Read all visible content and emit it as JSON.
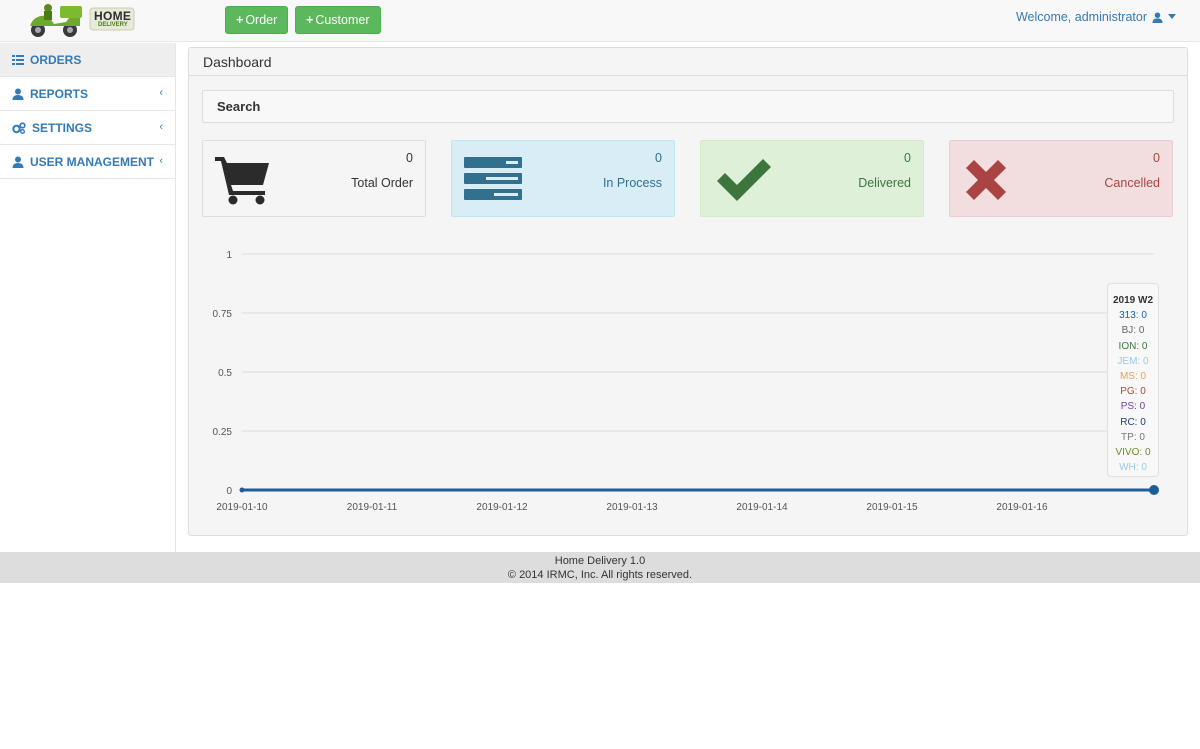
{
  "header": {
    "logo": {
      "line1": "HOME",
      "line2": "DELIVERY"
    },
    "order_button": "Order",
    "customer_button": "Customer",
    "welcome": "Welcome, administrator"
  },
  "sidebar": {
    "items": [
      {
        "label": "ORDERS",
        "icon": "list-icon",
        "active": true
      },
      {
        "label": "REPORTS",
        "icon": "user-icon"
      },
      {
        "label": "SETTINGS",
        "icon": "gears-icon"
      },
      {
        "label": "USER MANAGEMENT",
        "icon": "user-icon"
      }
    ]
  },
  "dashboard": {
    "title": "Dashboard",
    "search_label": "Search",
    "cards": [
      {
        "value": "0",
        "label": "Total Order",
        "icon": "cart-icon",
        "color": "#333333"
      },
      {
        "value": "0",
        "label": "In Process",
        "icon": "tasks-icon",
        "color": "#31708f"
      },
      {
        "value": "0",
        "label": "Delivered",
        "icon": "check-icon",
        "color": "#3c763d"
      },
      {
        "value": "0",
        "label": "Cancelled",
        "icon": "close-icon",
        "color": "#a94442"
      }
    ]
  },
  "chart_data": {
    "type": "line",
    "x": [
      "2019-01-10",
      "2019-01-11",
      "2019-01-12",
      "2019-01-13",
      "2019-01-14",
      "2019-01-15",
      "2019-01-16",
      "2019 W2"
    ],
    "x_ticks": [
      "2019-01-10",
      "2019-01-11",
      "2019-01-12",
      "2019-01-13",
      "2019-01-14",
      "2019-01-15",
      "2019-01-16"
    ],
    "y_ticks": [
      "0",
      "0.25",
      "0.5",
      "0.75",
      "1"
    ],
    "ylim": [
      0,
      1
    ],
    "series": [
      {
        "name": "313",
        "values": [
          0,
          0,
          0,
          0,
          0,
          0,
          0,
          0
        ],
        "color": "#1f5d99"
      }
    ],
    "tooltip": {
      "title": "2019 W2",
      "rows": [
        {
          "name": "313",
          "value": "0",
          "color": "#1f5d99"
        },
        {
          "name": "BJ",
          "value": "0",
          "color": "#666666"
        },
        {
          "name": "ION",
          "value": "0",
          "color": "#3c763d"
        },
        {
          "name": "JEM",
          "value": "0",
          "color": "#9ac8e0"
        },
        {
          "name": "MS",
          "value": "0",
          "color": "#e8a34a"
        },
        {
          "name": "PG",
          "value": "0",
          "color": "#a0522d"
        },
        {
          "name": "PS",
          "value": "0",
          "color": "#7b3fa0"
        },
        {
          "name": "RC",
          "value": "0",
          "color": "#1f3f77"
        },
        {
          "name": "TP",
          "value": "0",
          "color": "#777777"
        },
        {
          "name": "VIVO",
          "value": "0",
          "color": "#6b8e23"
        },
        {
          "name": "WH",
          "value": "0",
          "color": "#9ec9e8"
        }
      ]
    }
  },
  "footer": {
    "line1": "Home Delivery 1.0",
    "line2": "© 2014 IRMC, Inc. All rights reserved."
  }
}
